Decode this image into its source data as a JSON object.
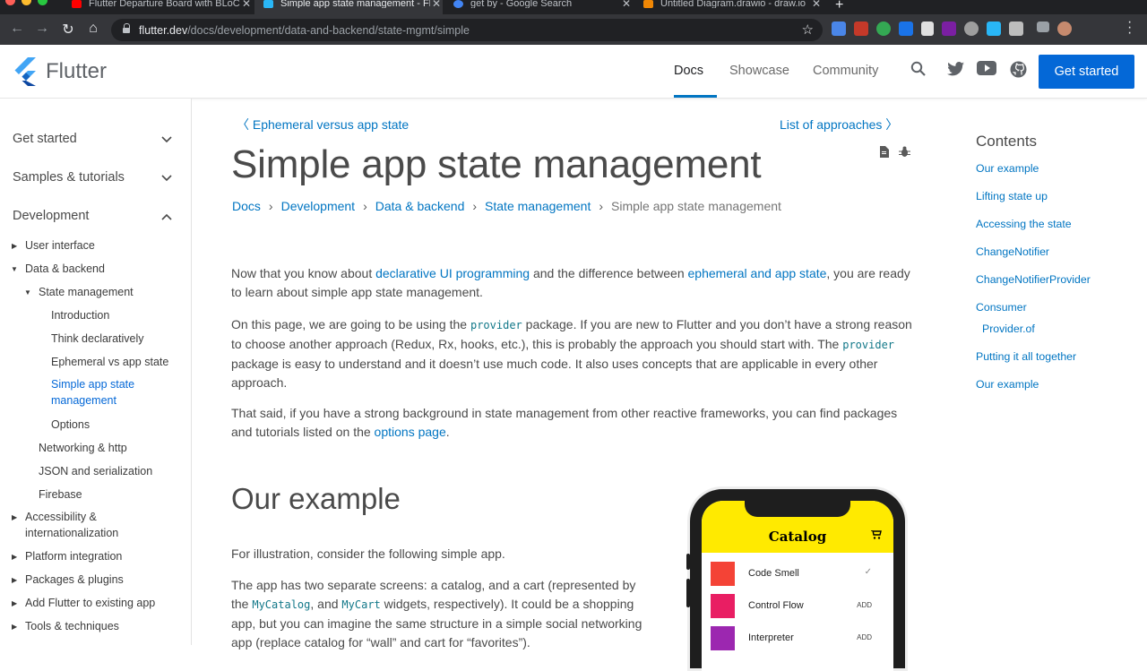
{
  "browser": {
    "tabs": [
      {
        "title": "Flutter Departure Board with BLoC",
        "favicon_color": "#ff0000"
      },
      {
        "title": "Simple app state management - Flutter",
        "favicon_color": "#29b6f6"
      },
      {
        "title": "get by - Google Search",
        "favicon_color": "#4285f4"
      },
      {
        "title": "Untitled Diagram.drawio - draw.io",
        "favicon_color": "#f08705"
      }
    ],
    "url_host": "flutter.dev",
    "url_path": "/docs/development/data-and-backend/state-mgmt/simple"
  },
  "header": {
    "logo_text": "Flutter",
    "nav": [
      "Docs",
      "Showcase",
      "Community"
    ],
    "cta": "Get started",
    "icons": [
      "search-icon",
      "twitter-icon",
      "youtube-icon",
      "github-icon"
    ]
  },
  "sidebar": {
    "top_sections": [
      "Get started",
      "Samples & tutorials",
      "Development"
    ],
    "items": [
      "User interface",
      "Data & backend",
      "State management",
      "Introduction",
      "Think declaratively",
      "Ephemeral vs app state",
      "Simple app state management",
      "Options",
      "Networking & http",
      "JSON and serialization",
      "Firebase",
      "Accessibility & internationalization",
      "Platform integration",
      "Packages & plugins",
      "Add Flutter to existing app",
      "Tools & techniques"
    ]
  },
  "main": {
    "prev_link": "Ephemeral versus app state",
    "next_link": "List of approaches",
    "title": "Simple app state management",
    "breadcrumb": [
      "Docs",
      "Development",
      "Data & backend",
      "State management",
      "Simple app state management"
    ],
    "p1": {
      "t1": "Now that you know about ",
      "l1": "declarative UI programming",
      "t2": " and the difference between ",
      "l2": "ephemeral and app state",
      "t3": ", you are ready to learn about simple app state management."
    },
    "p2": {
      "t1": "On this page, we are going to be using the ",
      "c1": "provider",
      "t2": " package. If you are new to Flutter and you don’t have a strong reason to choose another approach (Redux, Rx, hooks, etc.), this is probably the approach you should start with. The ",
      "c2": "provider",
      "t3": " package is easy to understand and it doesn’t use much code. It also uses concepts that are applicable in every other approach."
    },
    "p3": {
      "t1": "That said, if you have a strong background in state management from other reactive frameworks, you can find packages and tutorials listed on the ",
      "l1": "options page",
      "t2": "."
    },
    "h2": "Our example",
    "p4": "For illustration, consider the following simple app.",
    "p5": {
      "t1": "The app has two separate screens: a catalog, and a cart (represented by the ",
      "c1": "MyCatalog",
      "t2": ", and ",
      "c2": "MyCart",
      "t3": " widgets, respectively). It could be a shopping app, but you can imagine the same structure in a simple social networking app (replace catalog for “wall” and cart for “favorites”)."
    }
  },
  "phone": {
    "title": "Catalog",
    "items": [
      {
        "name": "Code Smell",
        "action": "✓",
        "color": "#f44336"
      },
      {
        "name": "Control Flow",
        "action": "ADD",
        "color": "#e91e63"
      },
      {
        "name": "Interpreter",
        "action": "ADD",
        "color": "#9c27b0"
      }
    ]
  },
  "toc": {
    "heading": "Contents",
    "items": [
      "Our example",
      "Lifting state up",
      "Accessing the state",
      "ChangeNotifier",
      "ChangeNotifierProvider",
      "Consumer",
      "Provider.of",
      "Putting it all together",
      "Our example"
    ]
  },
  "colors": {
    "brand": "#0468d7",
    "link": "#0175c2",
    "code": "#127889"
  }
}
